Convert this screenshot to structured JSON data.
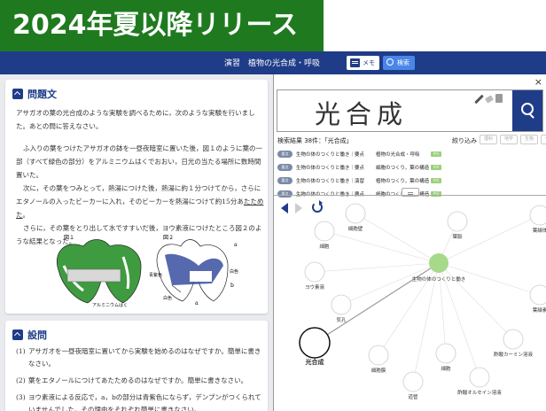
{
  "banner": {
    "text": "2024年夏以降リリース"
  },
  "topbar": {
    "title": "演習　植物の光合成・呼吸",
    "memo_label": "メモ",
    "search_label": "検索"
  },
  "problem": {
    "heading": "問題文",
    "intro": "アサガオの葉の光合成のような実験を調べるために，次のような実験を行いました。あとの問に答えなさい。",
    "p1": "ふ入りの葉をつけたアサガオの鉢を一昼夜暗室に置いた後，図１のように葉の一部（すべて緑色の部分）をアルミニウムはくでおおい，日光の当たる場所に数時間置いた。",
    "p2_a": "次に，その葉をつみとって，熱湯につけた後，熱湯に約１分つけてから，さらにエタノールの入ったビーカーに入れ，そのビーカーを熱湯につけて約15分あ",
    "p2_b": "たためた",
    "p2_c": "。",
    "p3": "さらに，その葉をとり出して水ですすいだ後，ヨウ素液につけたところ図２のような結果となった。",
    "fig1": "図１",
    "fig2": "図２",
    "foil": "アルミニウムはく",
    "purple": "青紫色",
    "white1": "白色",
    "white2": "白色",
    "label_a1": "a",
    "label_a2": "a",
    "label_b": "b"
  },
  "questions": {
    "heading": "設問",
    "items": [
      {
        "no": "(1)",
        "text": "アサガオを一昼夜暗室に置いてから実験を始めるのはなぜですか。簡単に書きなさい。"
      },
      {
        "no": "(2)",
        "text": "葉をエタノールにつけてあたためるのはなぜですか。簡単に書きなさい。"
      },
      {
        "no": "(3)",
        "text": "ヨウ素液による反応で，a，bの部分は青紫色にならず，デンプンがつくられていませんでした。その理由をそれぞれ簡単に書きなさい。"
      }
    ]
  },
  "panel": {
    "close": "×",
    "handwriting": "光合成",
    "result_count": "検索結果 38件：「光合成」",
    "filter_label": "絞り込み",
    "chips": [
      "理科",
      "地学",
      "生物",
      "化学"
    ],
    "results": [
      {
        "kind": "要点",
        "name": "生物の体のつくりと働き｜要点",
        "detail": "植物の光合成・呼吸",
        "tag": "中1"
      },
      {
        "kind": "要点",
        "name": "生物の体のつくりと働き｜要点",
        "detail": "細胞のつくり，葉の構造",
        "tag": "中2"
      },
      {
        "kind": "要点",
        "name": "生物の体のつくりと働き｜演習",
        "detail": "植物のつくり，葉の構造",
        "tag": "中2"
      },
      {
        "kind": "要点",
        "name": "生物の体のつくりと働き｜要点",
        "detail": "細胞のつくり，葉の構造",
        "tag": "中2"
      }
    ]
  },
  "graph": {
    "center": "生物の体のつくりと働き",
    "nodes": [
      "細胞壁",
      "細胞",
      "葉緑体",
      "葉緑素",
      "ヨウ素液",
      "気孔",
      "光合成",
      "細胞膜",
      "細胞",
      "道管",
      "酢酸カーミン溶液",
      "酢酸オルセイン溶液",
      "葉脈",
      "細胞質",
      "葉緑体"
    ]
  }
}
